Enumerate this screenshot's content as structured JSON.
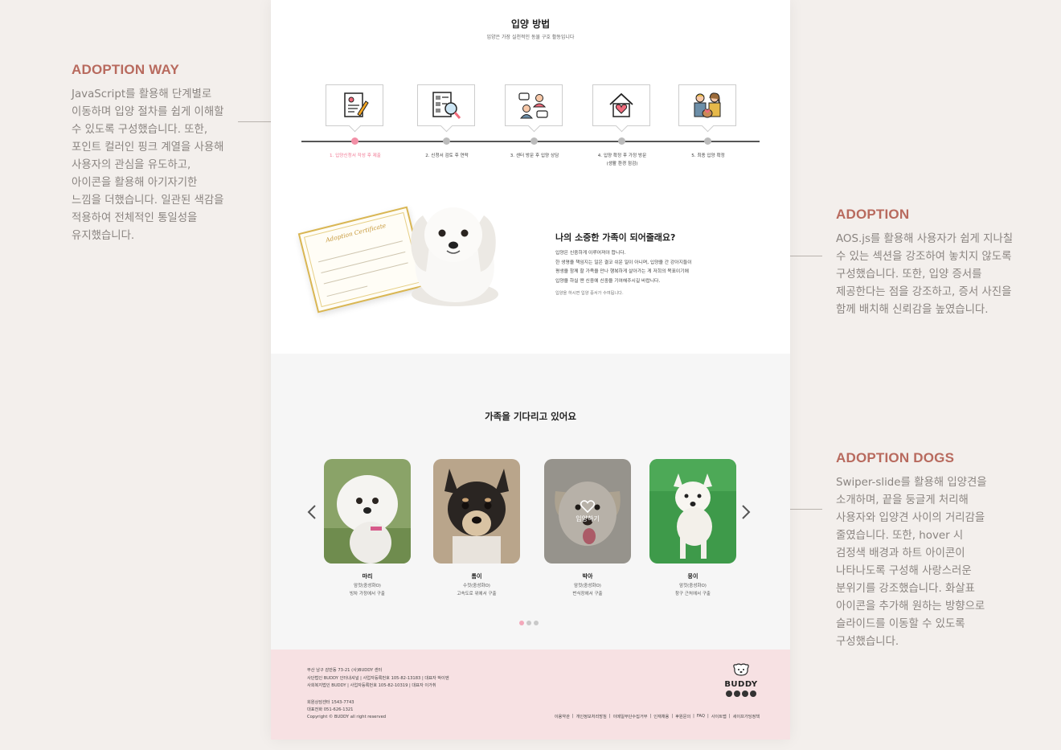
{
  "annotations": {
    "adoption_way": {
      "title": "ADOPTION WAY",
      "body": "JavaScript를 활용해 단계별로 이동하며 입양 절차를 쉽게 이해할 수 있도록 구성했습니다. 또한, 포인트 컬러인 핑크 계열을 사용해 사용자의 관심을 유도하고, 아이콘을 활용해 아기자기한 느낌을 더했습니다. 일관된 색감을 적용하여 전체적인 통일성을 유지했습니다."
    },
    "adoption": {
      "title": "ADOPTION",
      "body": "AOS.js를 활용해 사용자가 쉽게 지나칠 수 있는 섹션을 강조하여 놓치지 않도록 구성했습니다. 또한, 입양 증서를 제공한다는 점을 강조하고, 증서 사진을 함께 배치해 신뢰감을 높였습니다."
    },
    "adoption_dogs": {
      "title": "ADOPTION DOGS",
      "body": "Swiper-slide를 활용해 입양견을 소개하며, 끝을 둥글게 처리해 사용자와 입양견 사이의 거리감을 줄였습니다. 또한, hover 시 검정색 배경과 하트 아이콘이 나타나도록 구성해 사랑스러운 분위기를 강조했습니다. 화살표 아이콘을 추가해 원하는 방향으로 슬라이드를 이동할 수 있도록 구성했습니다."
    }
  },
  "process": {
    "title": "입양 방법",
    "subtitle": "입양은 가장 실천적인 동물 구호 활동입니다",
    "steps": [
      {
        "label": "1. 입양신청서 작성 후 제출",
        "icon": "application-form-icon",
        "active": true
      },
      {
        "label": "2. 신청서 검토 후 연락",
        "icon": "document-review-icon",
        "active": false
      },
      {
        "label": "3. 센터 방문 후 입양 상담",
        "icon": "consultation-icon",
        "active": false
      },
      {
        "label": "4. 입양 확정 후 가정 방문",
        "sublabel": "(생활 환경 점검)",
        "icon": "home-heart-icon",
        "active": false
      },
      {
        "label": "5. 최종 입양 확정",
        "icon": "family-icon",
        "active": false
      }
    ]
  },
  "certificate": {
    "cert_title": "Adoption Certificate",
    "headline": "나의 소중한 가족이 되어줄래요?",
    "body_lines": [
      "입양은 신중하게 이루어져야 합니다.",
      "한 생명을 책임지는 일은 결코 쉬운 일이 아니며, 입양을 간 강아지들이",
      "평생을 함께 할 가족을 만나 행복하게 살아가는 게 저희의 목표이기에",
      "입양을 하실 땐 신중에 신중을 기여해주시길 바랍니다."
    ],
    "note": "입양을 하시면 입양 증서가 수여됩니다."
  },
  "waiting": {
    "title": "가족을 기다리고 있어요",
    "hover_label": "입양하기",
    "dogs": [
      {
        "name": "마리",
        "info1": "암컷(중성화O)",
        "info2": "빙차 가정에서 구출"
      },
      {
        "name": "톰이",
        "info1": "수컷(중성화O)",
        "info2": "고속도로 위에서 구출"
      },
      {
        "name": "박아",
        "info1": "암컷(중성화O)",
        "info2": "번식장에서 구출"
      },
      {
        "name": "뭉이",
        "info1": "암컷(중성화O)",
        "info2": "창구 근처에서 구출"
      }
    ]
  },
  "footer": {
    "address_lines": [
      "부산 남구 감만동 73-21 (사)BUDDY 센터",
      "사단법인 BUDDY 인터내셔널 | 사업자등록번호 105-82-13183 | 대표자 박이엔",
      "사회복지법인 BUDDY | 사업자등록번호 105-82-10319 | 대표자 이가취"
    ],
    "contact_lines": [
      "회원상담센터 1543-7743",
      "대표전화 051-626-1321",
      "Copyright © BUDDY all right reserved"
    ],
    "links": [
      "이용약관",
      "개인정보처리방침",
      "이메일무단수집거부",
      "인재채용",
      "후원문의",
      "FAQ",
      "사이트맵",
      "세이프가딩정책"
    ],
    "logo": "BUDDY"
  },
  "colors": {
    "accent": "#b86a5e",
    "pink": "#f28fa6",
    "footer_bg": "#f7e1e3"
  }
}
